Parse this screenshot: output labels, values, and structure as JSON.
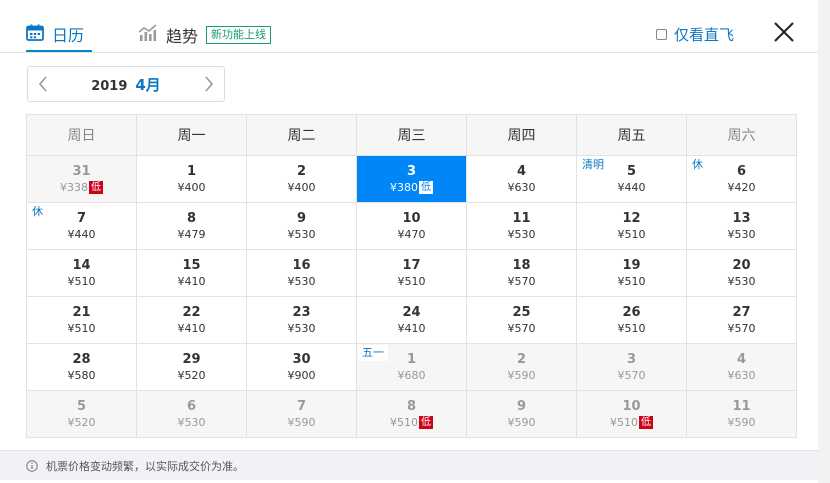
{
  "tabs": {
    "calendar": "日历",
    "trend": "趋势",
    "new_badge": "新功能上线"
  },
  "filter": {
    "direct_only_label": "仅看直飞",
    "checked": false
  },
  "month_picker": {
    "year": "2019",
    "month": "4月"
  },
  "weekdays": [
    "周日",
    "周一",
    "周二",
    "周三",
    "周四",
    "周五",
    "周六"
  ],
  "low_label": "低",
  "weeks": [
    [
      {
        "day": "31",
        "price": "¥338",
        "other": true,
        "low": true
      },
      {
        "day": "1",
        "price": "¥400"
      },
      {
        "day": "2",
        "price": "¥400"
      },
      {
        "day": "3",
        "price": "¥380",
        "selected": true,
        "low": true
      },
      {
        "day": "4",
        "price": "¥630"
      },
      {
        "day": "5",
        "price": "¥440",
        "holiday": "清明"
      },
      {
        "day": "6",
        "price": "¥420",
        "holiday": "休"
      }
    ],
    [
      {
        "day": "7",
        "price": "¥440",
        "holiday": "休"
      },
      {
        "day": "8",
        "price": "¥479"
      },
      {
        "day": "9",
        "price": "¥530"
      },
      {
        "day": "10",
        "price": "¥470"
      },
      {
        "day": "11",
        "price": "¥530"
      },
      {
        "day": "12",
        "price": "¥510"
      },
      {
        "day": "13",
        "price": "¥530"
      }
    ],
    [
      {
        "day": "14",
        "price": "¥510"
      },
      {
        "day": "15",
        "price": "¥410"
      },
      {
        "day": "16",
        "price": "¥530"
      },
      {
        "day": "17",
        "price": "¥510"
      },
      {
        "day": "18",
        "price": "¥570"
      },
      {
        "day": "19",
        "price": "¥510"
      },
      {
        "day": "20",
        "price": "¥530"
      }
    ],
    [
      {
        "day": "21",
        "price": "¥510"
      },
      {
        "day": "22",
        "price": "¥410"
      },
      {
        "day": "23",
        "price": "¥530"
      },
      {
        "day": "24",
        "price": "¥410"
      },
      {
        "day": "25",
        "price": "¥570"
      },
      {
        "day": "26",
        "price": "¥510"
      },
      {
        "day": "27",
        "price": "¥570"
      }
    ],
    [
      {
        "day": "28",
        "price": "¥580"
      },
      {
        "day": "29",
        "price": "¥520"
      },
      {
        "day": "30",
        "price": "¥900"
      },
      {
        "day": "1",
        "price": "¥680",
        "other": true,
        "holiday": "五一"
      },
      {
        "day": "2",
        "price": "¥590",
        "other": true
      },
      {
        "day": "3",
        "price": "¥570",
        "other": true
      },
      {
        "day": "4",
        "price": "¥630",
        "other": true
      }
    ],
    [
      {
        "day": "5",
        "price": "¥520",
        "other": true
      },
      {
        "day": "6",
        "price": "¥530",
        "other": true
      },
      {
        "day": "7",
        "price": "¥590",
        "other": true
      },
      {
        "day": "8",
        "price": "¥510",
        "other": true,
        "low": true
      },
      {
        "day": "9",
        "price": "¥590",
        "other": true
      },
      {
        "day": "10",
        "price": "¥510",
        "other": true,
        "low": true
      },
      {
        "day": "11",
        "price": "¥590",
        "other": true
      }
    ]
  ],
  "note": "机票价格变动频繁，以实际成交价为准。",
  "colors": {
    "accent": "#0c77c5",
    "selected": "#0086f6",
    "low": "#d0021b",
    "new_badge": "#1a9e6a"
  }
}
